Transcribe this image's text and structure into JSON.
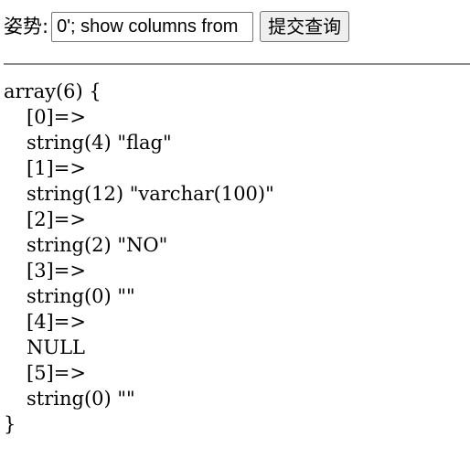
{
  "form": {
    "label": "姿势:",
    "input_value": "0'; show columns from",
    "submit_label": "提交查询"
  },
  "dump": {
    "open": "array(6) {",
    "entries": [
      {
        "key": "[0]=>",
        "value": "string(4) \"flag\""
      },
      {
        "key": "[1]=>",
        "value": "string(12) \"varchar(100)\""
      },
      {
        "key": "[2]=>",
        "value": "string(2) \"NO\""
      },
      {
        "key": "[3]=>",
        "value": "string(0) \"\""
      },
      {
        "key": "[4]=>",
        "value": "NULL"
      },
      {
        "key": "[5]=>",
        "value": "string(0) \"\""
      }
    ],
    "close": "}"
  }
}
